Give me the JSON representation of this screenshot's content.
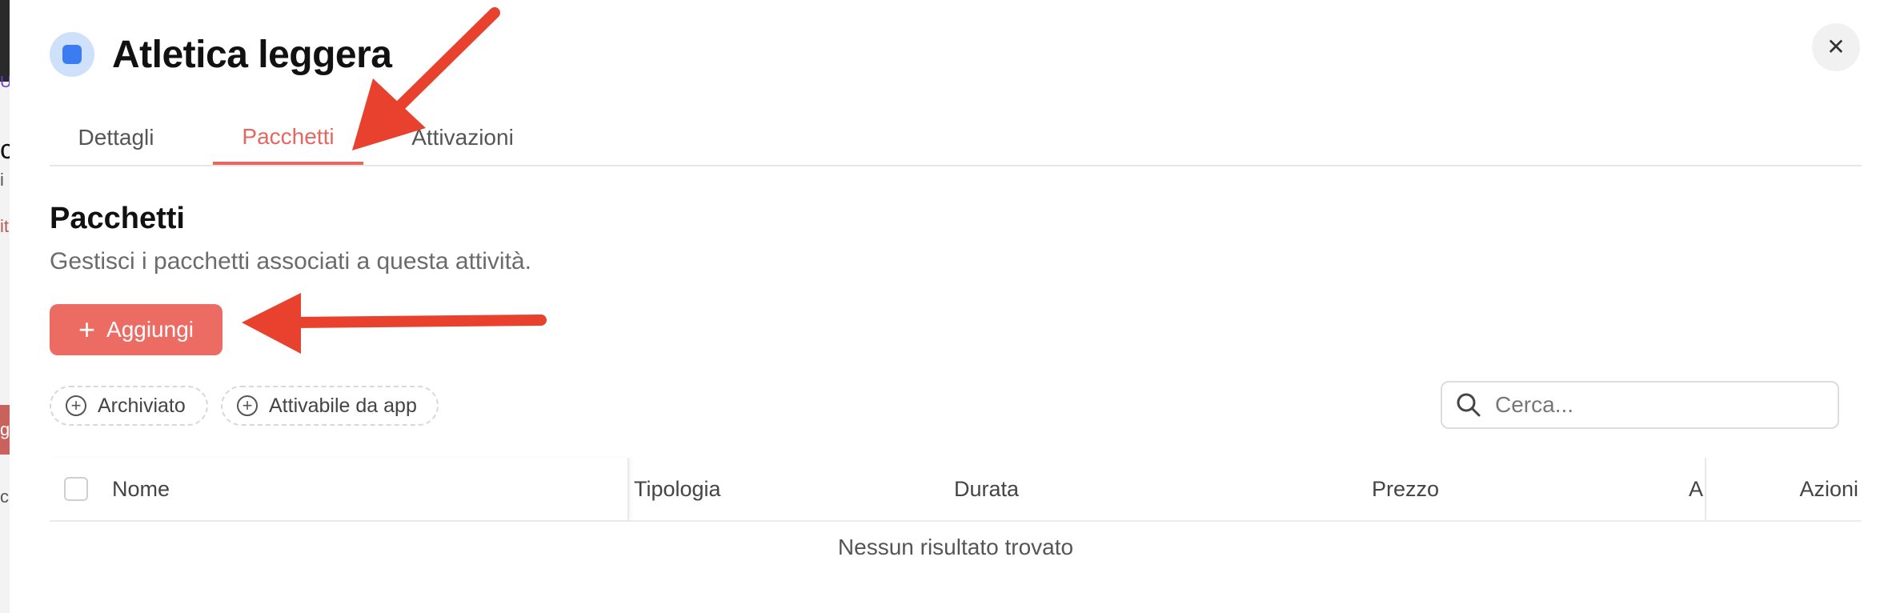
{
  "background": {
    "fragments": [
      "U",
      "c",
      "i",
      "it",
      "g",
      "c"
    ]
  },
  "header": {
    "title": "Atletica leggera",
    "close_icon": "close-icon"
  },
  "tabs": [
    {
      "label": "Dettagli",
      "active": false
    },
    {
      "label": "Pacchetti",
      "active": true
    },
    {
      "label": "Attivazioni",
      "active": false
    }
  ],
  "section": {
    "title": "Pacchetti",
    "subtitle": "Gestisci i pacchetti associati a questa attività."
  },
  "toolbar": {
    "add_label": "Aggiungi",
    "filters": [
      "Archiviato",
      "Attivabile da app"
    ],
    "search_placeholder": "Cerca..."
  },
  "table": {
    "columns": [
      "Nome",
      "Tipologia",
      "Durata",
      "Prezzo",
      "A",
      "Azioni"
    ],
    "empty_text": "Nessun risultato trovato"
  },
  "colors": {
    "accent": "#ec6c64",
    "active_tab": "#e4685f",
    "annotation_arrow": "#e8412e",
    "title_dot": "#3b7cf0"
  }
}
